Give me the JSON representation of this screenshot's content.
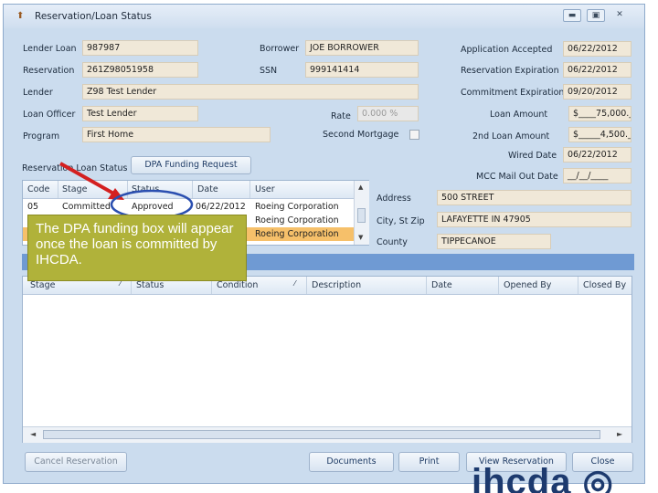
{
  "window": {
    "title": "Reservation/Loan Status"
  },
  "fields": {
    "lender_loan": {
      "label": "Lender Loan",
      "value": "987987"
    },
    "reservation": {
      "label": "Reservation",
      "value": "261Z98051958"
    },
    "lender": {
      "label": "Lender",
      "value": "Z98 Test Lender"
    },
    "loan_officer": {
      "label": "Loan Officer",
      "value": "Test Lender"
    },
    "program": {
      "label": "Program",
      "value": "First Home"
    },
    "borrower": {
      "label": "Borrower",
      "value": "JOE BORROWER"
    },
    "ssn": {
      "label": "SSN",
      "value": "999141414"
    },
    "rate": {
      "label": "Rate",
      "value": "0.000 %"
    },
    "second_mortgage": {
      "label": "Second Mortgage"
    },
    "application_accepted": {
      "label": "Application Accepted",
      "value": "06/22/2012"
    },
    "reservation_expiration": {
      "label": "Reservation Expiration",
      "value": "06/22/2012"
    },
    "commitment_expiration": {
      "label": "Commitment Expiration",
      "value": "09/20/2012"
    },
    "loan_amount": {
      "label": "Loan Amount",
      "value": "$____75,000._ _"
    },
    "second_loan_amount": {
      "label": "2nd Loan Amount",
      "value": "$_____4,500._ _"
    },
    "wired_date": {
      "label": "Wired Date",
      "value": "06/22/2012"
    },
    "mcc_mail_out_date": {
      "label": "MCC Mail Out Date",
      "value": "__/__/____"
    },
    "address": {
      "label": "Address",
      "value": "500 STREET"
    },
    "city_st_zip": {
      "label": "City, St  Zip",
      "value": "LAFAYETTE IN  47905"
    },
    "county": {
      "label": "County",
      "value": "TIPPECANOE"
    }
  },
  "status_section": {
    "label": "Reservation Loan Status",
    "dpa_button": "DPA Funding Request",
    "columns": [
      "Code",
      "Stage",
      "Status",
      "Date",
      "User"
    ],
    "rows": [
      {
        "code": "05",
        "stage": "Committed",
        "status": "Approved",
        "date": "06/22/2012",
        "user": "Roeing Corporation"
      },
      {
        "code": "",
        "stage": "",
        "status": "",
        "date": "",
        "user": "Roeing Corporation"
      },
      {
        "code": "",
        "stage": "",
        "status": "",
        "date": "",
        "user": "Roeing Corporation"
      }
    ]
  },
  "conditions_grid": {
    "columns": [
      "Stage",
      "Status",
      "Condition",
      "Description",
      "Date",
      "Opened By",
      "Closed By"
    ]
  },
  "callout": {
    "text": "The DPA funding box will appear once the loan is committed by IHCDA."
  },
  "buttons": {
    "cancel_reservation": "Cancel Reservation",
    "documents": "Documents",
    "print": "Print",
    "view_reservation": "View Reservation",
    "close": "Close"
  },
  "logo": {
    "text": "ihcda"
  },
  "colors": {
    "window_bg": "#cbdcee",
    "field_bg": "#f0e8d8",
    "callout_bg": "#b0b23a",
    "highlight_row": "#f6c06a",
    "arrow": "#d42020",
    "ellipse": "#2b4fb0"
  }
}
